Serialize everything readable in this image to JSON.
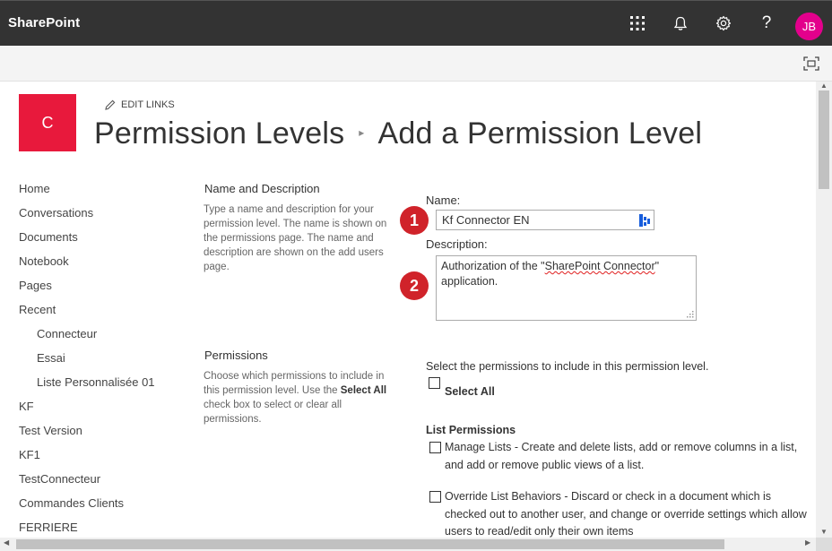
{
  "suite_bar": {
    "brand": "SharePoint",
    "icons": [
      "app-launcher-icon",
      "bell-icon",
      "gear-icon",
      "help-icon"
    ],
    "avatar_initials": "JB",
    "avatar_color": "#e3008c"
  },
  "ribbon": {
    "focus_icon": "focus-mode-icon"
  },
  "site": {
    "logo_letter": "C",
    "logo_color": "#e8193c",
    "edit_links_label": "EDIT LINKS",
    "breadcrumb_parent": "Permission Levels",
    "breadcrumb_current": "Add a Permission Level"
  },
  "left_nav": {
    "items": [
      {
        "label": "Home",
        "sub": false
      },
      {
        "label": "Conversations",
        "sub": false
      },
      {
        "label": "Documents",
        "sub": false
      },
      {
        "label": "Notebook",
        "sub": false
      },
      {
        "label": "Pages",
        "sub": false
      },
      {
        "label": "Recent",
        "sub": false
      },
      {
        "label": "Connecteur",
        "sub": true
      },
      {
        "label": "Essai",
        "sub": true
      },
      {
        "label": "Liste Personnalisée 01",
        "sub": true
      },
      {
        "label": "KF",
        "sub": false
      },
      {
        "label": "Test Version",
        "sub": false
      },
      {
        "label": "KF1",
        "sub": false
      },
      {
        "label": "TestConnecteur",
        "sub": false
      },
      {
        "label": "Commandes Clients",
        "sub": false
      },
      {
        "label": "FERRIERE",
        "sub": false
      }
    ]
  },
  "name_section": {
    "title": "Name and Description",
    "description": "Type a name and description for your permission level.  The name is shown on the permissions page.  The name and description are shown on the add users page.",
    "name_label": "Name:",
    "name_value": "Kf Connector EN",
    "description_label": "Description:",
    "description_value_pre": "Authorization of the \"",
    "description_value_marked": "SharePoint Connector",
    "description_value_post": "\"\napplication."
  },
  "badges": {
    "one": "1",
    "two": "2",
    "color": "#d0232a"
  },
  "permissions_section": {
    "title": "Permissions",
    "description_pre": "Choose which permissions to include in this permission level.  Use the ",
    "description_bold": "Select All",
    "description_post": " check box to select or clear all permissions.",
    "intro": "Select the permissions to include in this permission level.",
    "select_all_label": "Select All",
    "group_title": "List Permissions",
    "items": [
      {
        "label": "Manage Lists  -  Create and delete lists, add or remove columns in a list, and add or remove public views of a list.",
        "checked": false
      },
      {
        "label": "Override List Behaviors  -  Discard or check in a document which is checked out to another user, and change or override settings which allow users to read/edit only their own items",
        "checked": false
      }
    ]
  }
}
